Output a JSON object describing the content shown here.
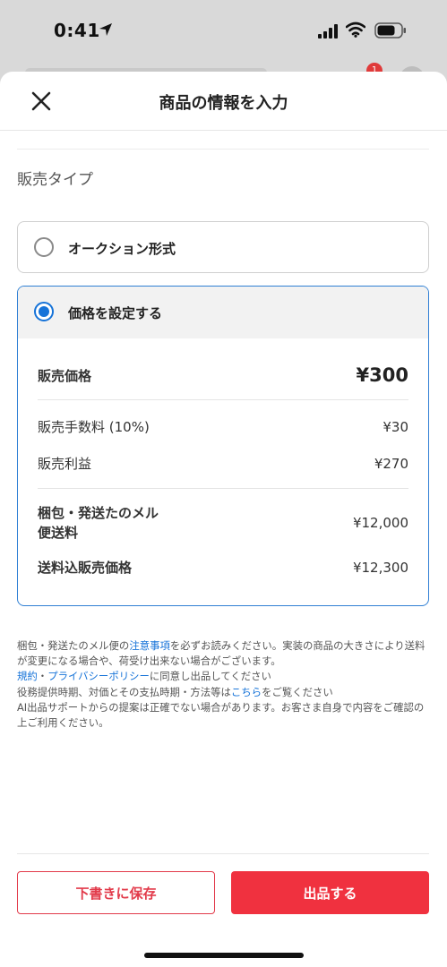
{
  "status_bar": {
    "time": "0:41",
    "icons": [
      "location-arrow-icon",
      "signal-icon",
      "wifi-icon",
      "battery-icon"
    ]
  },
  "background": {
    "notification_badge": "1"
  },
  "header": {
    "close_icon": "close-icon",
    "title": "商品の情報を入力"
  },
  "sale_type": {
    "section_label": "販売タイプ",
    "options": [
      {
        "label": "オークション形式",
        "selected": false
      },
      {
        "label": "価格を設定する",
        "selected": true
      }
    ]
  },
  "pricing": {
    "sale_price_label": "販売価格",
    "sale_price_value": "¥300",
    "fee_label": "販売手数料 (10%)",
    "fee_value": "¥30",
    "profit_label": "販売利益",
    "profit_value": "¥270",
    "shipping_label_line1": "梱包・発送たのメル",
    "shipping_label_line2": "便送料",
    "shipping_value": "¥12,000",
    "total_label": "送料込販売価格",
    "total_value": "¥12,300"
  },
  "notes": {
    "line1_pre": "梱包・発送たのメル便の",
    "line1_link": "注意事項",
    "line1_post": "を必ずお読みください。実装の商品の大きさにより送料が変更になる場合や、荷受け出来ない場合がございます。",
    "line2_link1": "規約",
    "line2_sep": "・",
    "line2_link2": "プライバシーポリシー",
    "line2_post": "に同意し出品してください",
    "line3_pre": "役務提供時期、対価とその支払時期・方法等は",
    "line3_link": "こちら",
    "line3_post": "をご覧ください",
    "line4": "AI出品サポートからの提案は正確でない場合があります。お客さま自身で内容をご確認の上ご利用ください。"
  },
  "footer": {
    "draft_button": "下書きに保存",
    "submit_button": "出品する"
  },
  "colors": {
    "accent_blue": "#1673d8",
    "brand_red": "#f0313f"
  }
}
